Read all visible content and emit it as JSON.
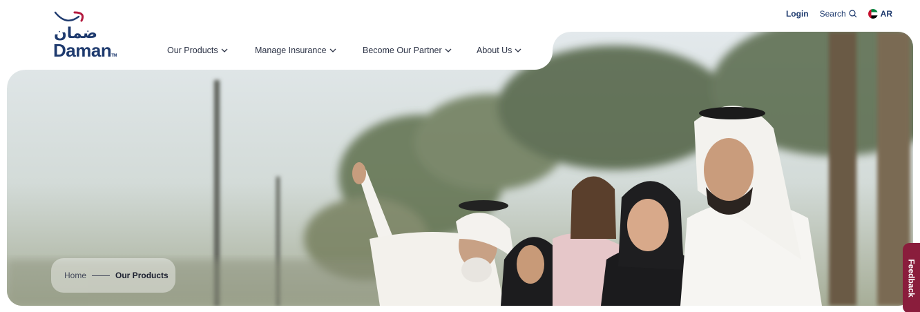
{
  "brand": {
    "arabic_name": "ضمان",
    "latin_name": "Daman",
    "tm": "TM",
    "primary_color": "#1e3a6e",
    "accent_color": "#b31b3f"
  },
  "nav": {
    "items": [
      {
        "label": "Our Products",
        "icon": "chevron-down-icon"
      },
      {
        "label": "Manage Insurance",
        "icon": "chevron-down-icon"
      },
      {
        "label": "Become Our Partner",
        "icon": "chevron-down-icon"
      },
      {
        "label": "About Us",
        "icon": "chevron-down-icon"
      }
    ]
  },
  "utilities": {
    "login": "Login",
    "search": "Search",
    "search_icon": "search-icon",
    "language": "AR",
    "language_icon": "uae-flag-icon"
  },
  "breadcrumb": {
    "home": "Home",
    "current": "Our Products"
  },
  "feedback": {
    "label": "Feedback",
    "color": "#8a1d3c"
  }
}
